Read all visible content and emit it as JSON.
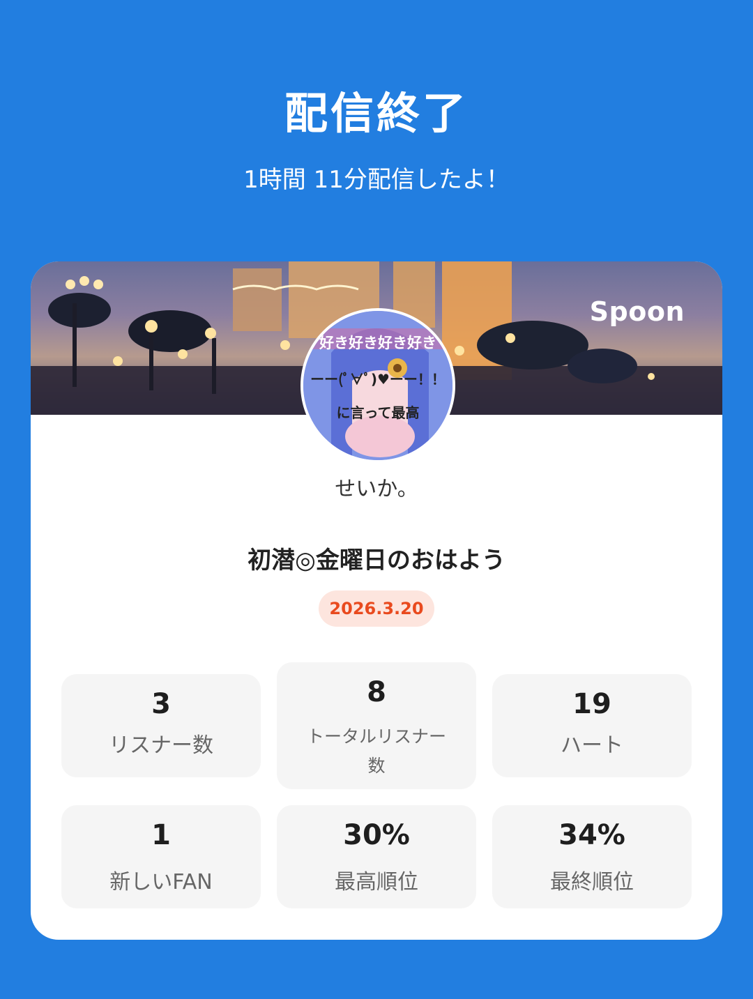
{
  "header": {
    "title": "配信終了",
    "subtitle": "1時間 11分配信したよ！"
  },
  "card": {
    "brand": "Spoon",
    "avatar_text": [
      "好き好き好き好き",
      "ーー(ﾟ∀ﾟ)♥ーー！！",
      "に言って最高"
    ],
    "username": "せいか。",
    "stream_title": "初潜◎金曜日のおはよう",
    "date": "2026.3.20",
    "stats": [
      {
        "value": "3",
        "label": "リスナー数"
      },
      {
        "value": "8",
        "label": "トータルリスナー数"
      },
      {
        "value": "19",
        "label": "ハート"
      },
      {
        "value": "1",
        "label": "新しいFAN"
      },
      {
        "value": "30%",
        "label": "最高順位"
      },
      {
        "value": "34%",
        "label": "最終順位"
      }
    ]
  },
  "colors": {
    "background": "#227ee0",
    "card": "#ffffff",
    "badge_bg": "#fde5de",
    "badge_text": "#e94a1e",
    "stat_bg": "#f5f5f5"
  }
}
